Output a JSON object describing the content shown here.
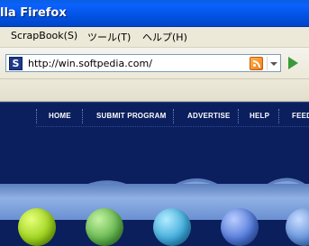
{
  "window": {
    "title": "lla Firefox"
  },
  "menubar": {
    "items": [
      "ScrapBook(S)",
      "ツール(T)",
      "ヘルプ(H)"
    ]
  },
  "address_bar": {
    "url": "http://win.softpedia.com/",
    "favicon_letter": "S"
  },
  "site_nav": {
    "links": [
      "HOME",
      "SUBMIT PROGRAM",
      "ADVERTISE",
      "HELP",
      "FEED"
    ]
  },
  "colors": {
    "titlebar": "#0b61ff",
    "chrome": "#ece9d8",
    "page_bg": "#0b1f5e",
    "ball_colors": [
      "#9ad018",
      "#5fb24a",
      "#39a7d8",
      "#4c74d6",
      "#5d8dd8"
    ]
  },
  "icons": {
    "favicon": "softpedia-favicon",
    "rss": "rss-feed-icon",
    "dropdown": "chevron-down-icon",
    "go": "go-arrow-icon"
  }
}
